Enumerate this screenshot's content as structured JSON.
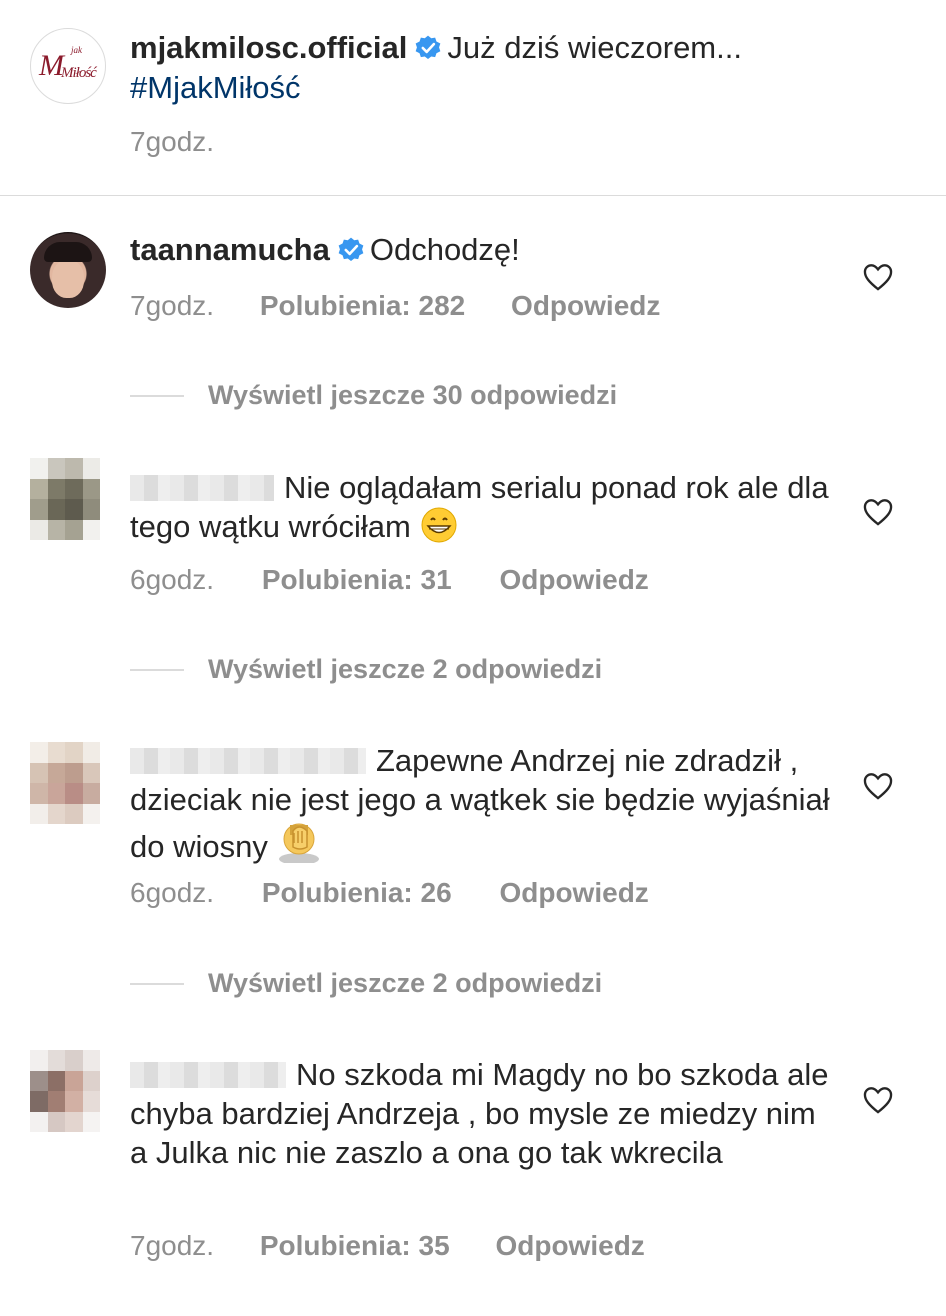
{
  "post": {
    "username": "mjakmilosc.official",
    "caption": "Już dziś wieczorem...",
    "hashtag": "#MjakMiłość",
    "time": "7godz.",
    "logo_text": "Miłość",
    "logo_small": "jak",
    "logo_m": "M"
  },
  "comments": [
    {
      "username": "taannamucha",
      "verified": true,
      "text": "Odchodzę!",
      "time": "7godz.",
      "likes": "Polubienia: 282",
      "reply": "Odpowiedz",
      "more_replies": "Wyświetl jeszcze 30 odpowiedzi"
    },
    {
      "username": "",
      "text": "Nie oglądałam serialu ponad rok ale dla tego wątku wróciłam",
      "emoji": "grinning-face",
      "time": "6godz.",
      "likes": "Polubienia: 31",
      "reply": "Odpowiedz",
      "more_replies": "Wyświetl jeszcze 2 odpowiedzi"
    },
    {
      "username": "",
      "text": "Zapewne Andrzej nie zdradził , dzieciak nie jest jego  a wątkek sie będzie wyjaśniał do wiosny",
      "emoji": "face-palm",
      "time": "6godz.",
      "likes": "Polubienia: 26",
      "reply": "Odpowiedz",
      "more_replies": "Wyświetl jeszcze 2 odpowiedzi"
    },
    {
      "username": "",
      "text": "No szkoda mi Magdy no bo szkoda ale chyba bardziej Andrzeja , bo mysle ze miedzy nim a Julka nic nie zaszlo a ona go tak wkrecila",
      "time": "7godz.",
      "likes": "Polubienia: 35",
      "reply": "Odpowiedz"
    }
  ],
  "colors": {
    "verified": "#3897f0",
    "hashtag": "#003569",
    "meta": "#8e8e8e",
    "text": "#262626"
  },
  "icons": [
    "verified-badge-icon",
    "heart-icon",
    "grinning-face-emoji",
    "face-palm-emoji"
  ]
}
